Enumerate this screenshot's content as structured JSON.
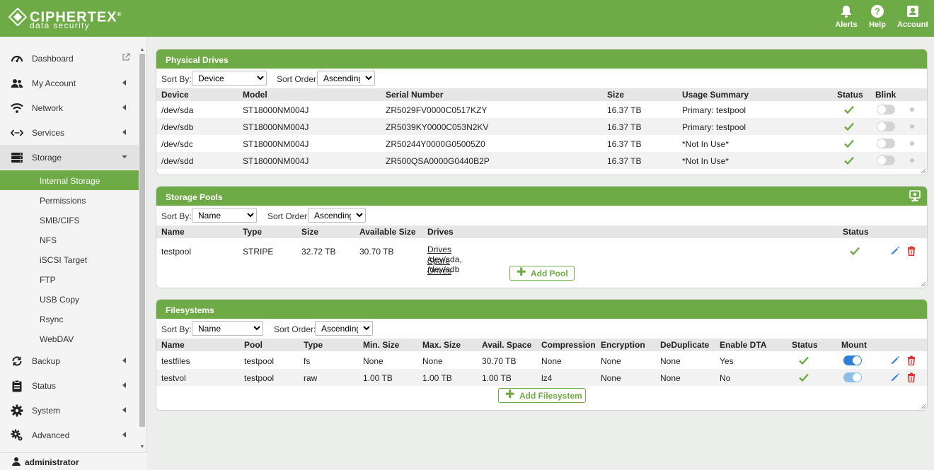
{
  "brand": {
    "name": "CIPHERTEX",
    "registered": "®",
    "tagline": "data security"
  },
  "header": {
    "actions": [
      {
        "label": "Alerts",
        "icon": "bell-icon"
      },
      {
        "label": "Help",
        "icon": "help-icon"
      },
      {
        "label": "Account",
        "icon": "account-icon"
      }
    ]
  },
  "sidebar": {
    "items": [
      {
        "label": "Dashboard",
        "icon": "dashboard-icon",
        "trailing": "external-link-icon"
      },
      {
        "label": "My Account",
        "icon": "users-icon",
        "trailing": "chevron-left-icon"
      },
      {
        "label": "Network",
        "icon": "wifi-icon",
        "trailing": "chevron-left-icon"
      },
      {
        "label": "Services",
        "icon": "services-icon",
        "trailing": "chevron-left-icon"
      },
      {
        "label": "Storage",
        "icon": "storage-icon",
        "trailing": "chevron-down-icon"
      },
      {
        "label": "Backup",
        "icon": "backup-icon",
        "trailing": "chevron-left-icon"
      },
      {
        "label": "Status",
        "icon": "clipboard-icon",
        "trailing": "chevron-left-icon"
      },
      {
        "label": "System",
        "icon": "gear-icon",
        "trailing": "chevron-left-icon"
      },
      {
        "label": "Advanced",
        "icon": "gears-icon",
        "trailing": "chevron-left-icon"
      }
    ],
    "storage_sub": [
      "Internal Storage",
      "Permissions",
      "SMB/CIFS",
      "NFS",
      "iSCSI Target",
      "FTP",
      "USB Copy",
      "Rsync",
      "WebDAV"
    ],
    "active_sub": "Internal Storage",
    "user": "administrator"
  },
  "physical_drives": {
    "title": "Physical Drives",
    "sort_by_label": "Sort By:",
    "sort_by_value": "Device",
    "sort_order_label": "Sort Order:",
    "sort_order_value": "Ascending",
    "columns": [
      "Device",
      "Model",
      "Serial Number",
      "Size",
      "Usage Summary",
      "Status",
      "Blink"
    ],
    "rows": [
      {
        "device": "/dev/sda",
        "model": "ST18000NM004J",
        "serial": "ZR5029FV0000C0517KZY",
        "size": "16.37 TB",
        "usage": "Primary: testpool",
        "blink": false
      },
      {
        "device": "/dev/sdb",
        "model": "ST18000NM004J",
        "serial": "ZR5039KY0000C053N2KV",
        "size": "16.37 TB",
        "usage": "Primary: testpool",
        "blink": false
      },
      {
        "device": "/dev/sdc",
        "model": "ST18000NM004J",
        "serial": "ZR50244Y0000G05005Z0",
        "size": "16.37 TB",
        "usage": "*Not In Use*",
        "blink": false
      },
      {
        "device": "/dev/sdd",
        "model": "ST18000NM004J",
        "serial": "ZR500QSA0000G0440B2P",
        "size": "16.37 TB",
        "usage": "*Not In Use*",
        "blink": false
      }
    ]
  },
  "storage_pools": {
    "title": "Storage Pools",
    "sort_by_label": "Sort By:",
    "sort_by_value": "Name",
    "sort_order_label": "Sort Order:",
    "sort_order_value": "Ascending",
    "columns": [
      "Name",
      "Type",
      "Size",
      "Available Size",
      "Drives",
      "Status"
    ],
    "rows": [
      {
        "name": "testpool",
        "type": "STRIPE",
        "size": "32.72 TB",
        "available": "30.70 TB",
        "drives_label": "Drives",
        "drives_value": ": /dev/sda,  /dev/sdb",
        "spare_label": "Spare Drives",
        "spare_value": ":"
      }
    ],
    "add_label": "Add Pool"
  },
  "filesystems": {
    "title": "Filesystems",
    "sort_by_label": "Sort By:",
    "sort_by_value": "Name",
    "sort_order_label": "Sort Order:",
    "sort_order_value": "Ascending",
    "columns": [
      "Name",
      "Pool",
      "Type",
      "Min. Size",
      "Max. Size",
      "Avail. Space",
      "Compression",
      "Encryption",
      "DeDuplicate",
      "Enable DTA",
      "Status",
      "Mount"
    ],
    "rows": [
      {
        "name": "testfiles",
        "pool": "testpool",
        "type": "fs",
        "min": "None",
        "max": "None",
        "avail": "30.70 TB",
        "compression": "None",
        "encryption": "None",
        "dedup": "None",
        "dta": "Yes",
        "mounted": true
      },
      {
        "name": "testvol",
        "pool": "testpool",
        "type": "raw",
        "min": "1.00 TB",
        "max": "1.00 TB",
        "avail": "1.00 TB",
        "compression": "lz4",
        "encryption": "None",
        "dedup": "None",
        "dta": "No",
        "mounted": true
      }
    ],
    "add_label": "Add Filesystem"
  },
  "colors": {
    "brand_green": "#6eaa45",
    "status_green": "#6eaa45",
    "edit_blue": "#2f7ed8",
    "delete_red": "#d9302c"
  }
}
